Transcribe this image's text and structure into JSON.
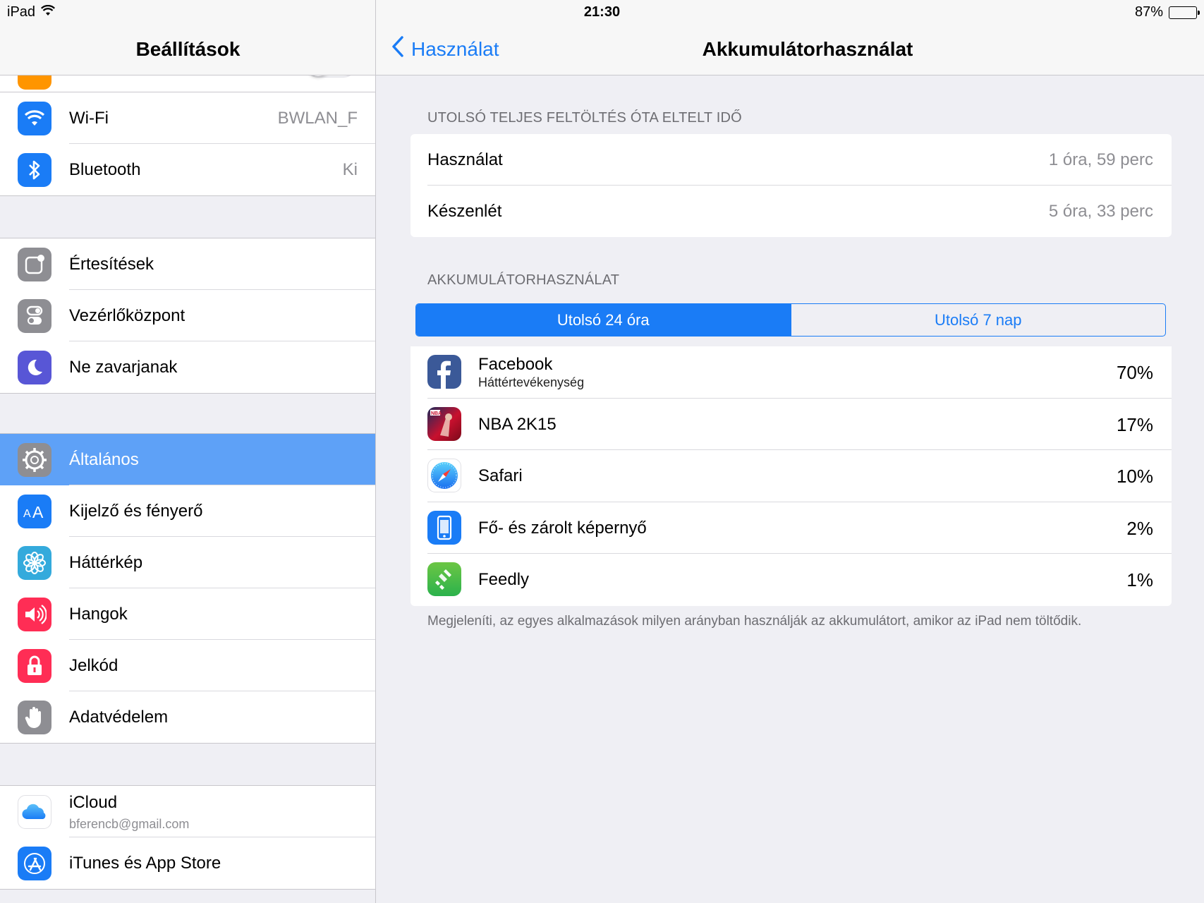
{
  "status": {
    "device": "iPad",
    "time": "21:30",
    "battery_text": "87%",
    "battery_level": 0.87
  },
  "master": {
    "title": "Beállítások",
    "groups": [
      {
        "rows": [
          {
            "label": "Wi-Fi",
            "value": "BWLAN_F",
            "icon": "wifi-icon",
            "color": "#1a7cf6"
          },
          {
            "label": "Bluetooth",
            "value": "Ki",
            "icon": "bluetooth-icon",
            "color": "#1a7cf6"
          }
        ]
      },
      {
        "rows": [
          {
            "label": "Értesítések",
            "icon": "notifications-icon",
            "color": "#8e8e93"
          },
          {
            "label": "Vezérlőközpont",
            "icon": "control-center-icon",
            "color": "#8e8e93"
          },
          {
            "label": "Ne zavarjanak",
            "icon": "moon-icon",
            "color": "#5856d6"
          }
        ]
      },
      {
        "rows": [
          {
            "label": "Általános",
            "icon": "gear-icon",
            "color": "#8e8e93",
            "selected": true
          },
          {
            "label": "Kijelző és fényerő",
            "icon": "text-size-icon",
            "color": "#1a7cf6"
          },
          {
            "label": "Háttérkép",
            "icon": "flower-icon",
            "color": "#34aadc"
          },
          {
            "label": "Hangok",
            "icon": "speaker-icon",
            "color": "#ff2d55"
          },
          {
            "label": "Jelkód",
            "icon": "lock-icon",
            "color": "#ff2d55"
          },
          {
            "label": "Adatvédelem",
            "icon": "hand-icon",
            "color": "#8e8e93"
          }
        ]
      },
      {
        "rows": [
          {
            "label": "iCloud",
            "sublabel": "bferencb@gmail.com",
            "icon": "cloud-icon",
            "color": "#ffffff"
          },
          {
            "label": "iTunes és App Store",
            "icon": "app-store-icon",
            "color": "#1a7cf6"
          }
        ]
      }
    ]
  },
  "detail": {
    "back_label": "Használat",
    "title": "Akkumulátorhasználat",
    "section1_title": "UTOLSÓ TELJES FELTÖLTÉS ÓTA ELTELT IDŐ",
    "usage_rows": [
      {
        "label": "Használat",
        "value": "1 óra, 59 perc"
      },
      {
        "label": "Készenlét",
        "value": "5 óra, 33 perc"
      }
    ],
    "section2_title": "AKKUMULÁTORHASZNÁLAT",
    "segments": [
      {
        "label": "Utolsó 24 óra",
        "active": true
      },
      {
        "label": "Utolsó 7 nap",
        "active": false
      }
    ],
    "apps": [
      {
        "name": "Facebook",
        "sub": "Háttértevékenység",
        "pct": "70%",
        "icon": "facebook-icon"
      },
      {
        "name": "NBA 2K15",
        "pct": "17%",
        "icon": "nba-2k15-icon"
      },
      {
        "name": "Safari",
        "pct": "10%",
        "icon": "safari-icon"
      },
      {
        "name": "Fő- és zárolt képernyő",
        "pct": "2%",
        "icon": "home-lock-screen-icon"
      },
      {
        "name": "Feedly",
        "pct": "1%",
        "icon": "feedly-icon"
      }
    ],
    "footnote": "Megjeleníti, az egyes alkalmazások milyen arányban használják az akkumulátort, amikor az iPad nem töltődik."
  }
}
